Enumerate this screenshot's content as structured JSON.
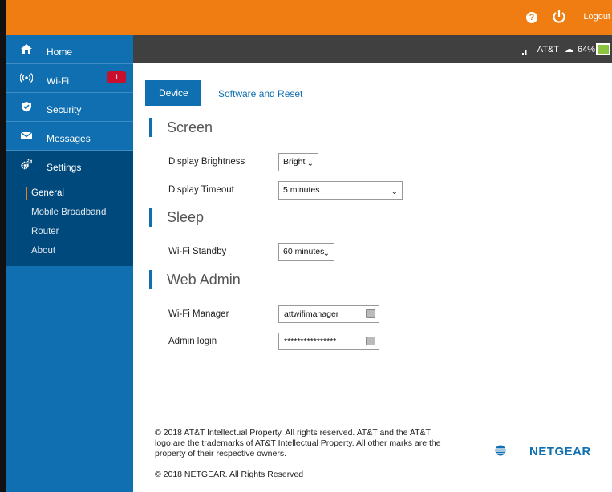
{
  "header": {
    "logout_label": "Logout",
    "help_glyph": "?"
  },
  "status": {
    "carrier": "AT&T",
    "battery_percent": "64%"
  },
  "sidebar": {
    "items": [
      {
        "label": "Home",
        "icon": "home-icon"
      },
      {
        "label": "Wi-Fi",
        "icon": "wifi-icon",
        "badge": "1"
      },
      {
        "label": "Security",
        "icon": "shield-icon"
      },
      {
        "label": "Messages",
        "icon": "envelope-icon"
      },
      {
        "label": "Settings",
        "icon": "gears-icon"
      }
    ],
    "sub_items": [
      {
        "label": "General"
      },
      {
        "label": "Mobile Broadband"
      },
      {
        "label": "Router"
      },
      {
        "label": "About"
      }
    ]
  },
  "tabs": {
    "device": "Device",
    "software_reset": "Software and Reset"
  },
  "screen": {
    "title": "Screen",
    "brightness_label": "Display Brightness",
    "brightness_value": "Bright",
    "timeout_label": "Display Timeout",
    "timeout_value": "5 minutes"
  },
  "sleep": {
    "title": "Sleep",
    "standby_label": "Wi-Fi Standby",
    "standby_value": "60 minutes"
  },
  "web_admin": {
    "title": "Web Admin",
    "manager_label": "Wi-Fi Manager",
    "manager_value": "attwifimanager",
    "login_label": "Admin login",
    "login_value": "****************"
  },
  "footer": {
    "copyright_att_1": "© 2018 AT&T Intellectual Property. All rights reserved. AT&T and the AT&T",
    "copyright_att_2": "logo are the trademarks of AT&T Intellectual Property. All other marks are the",
    "copyright_att_3": "property of their respective owners.",
    "copyright_netgear": "© 2018 NETGEAR. All Rights Reserved",
    "brand": "NETGEAR"
  },
  "colors": {
    "topbar": "#ef7d11",
    "sidebar": "#0f6fb0",
    "sidebar_active": "#00497c",
    "statusbar": "#404040",
    "badge": "#c8102e",
    "battery": "#8bc53f"
  }
}
